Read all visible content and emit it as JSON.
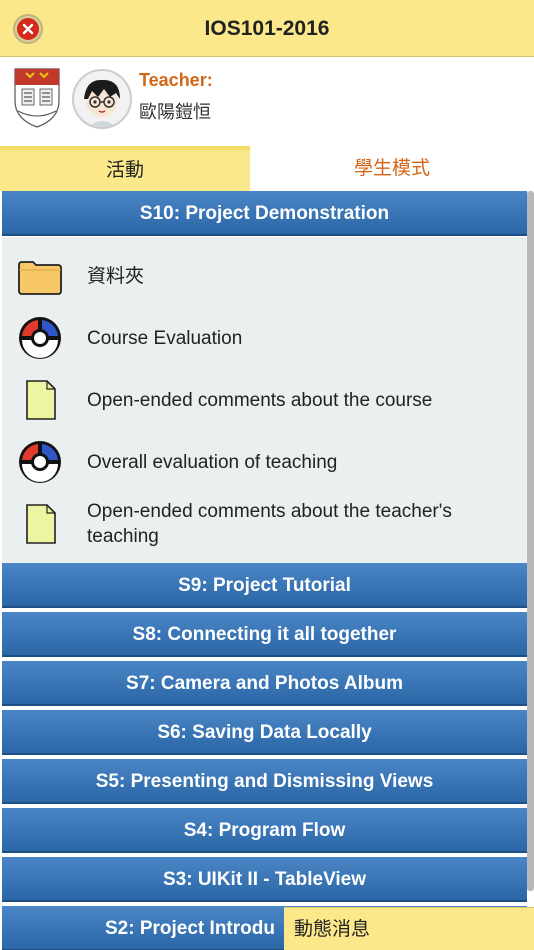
{
  "header": {
    "title": "IOS101-2016"
  },
  "teacher": {
    "label": "Teacher:",
    "name": "歐陽鎧恒"
  },
  "tabs": {
    "activity": "活動",
    "student_mode": "學生模式"
  },
  "sessions": {
    "s10": "S10: Project Demonstration",
    "s9": "S9: Project Tutorial",
    "s8": "S8: Connecting it all together",
    "s7": "S7: Camera and Photos Album",
    "s6": "S6: Saving Data Locally",
    "s5": "S5: Presenting and Dismissing Views",
    "s4": "S4: Program Flow",
    "s3": "S3: UIKit II - TableView",
    "s2": "S2: Project Introdu"
  },
  "items": [
    {
      "label": "資料夾",
      "icon": "folder-icon"
    },
    {
      "label": "Course Evaluation",
      "icon": "evaluation-icon"
    },
    {
      "label": "Open-ended comments about the course",
      "icon": "document-icon"
    },
    {
      "label": "Overall evaluation of teaching",
      "icon": "evaluation-icon"
    },
    {
      "label": "Open-ended comments about the teacher's teaching",
      "icon": "document-icon"
    }
  ],
  "bottom": {
    "news_label": "動態消息"
  },
  "colors": {
    "accent_yellow": "#fbe88a",
    "session_blue": "#3a76b6",
    "teacher_orange": "#d4661a",
    "close_red": "#d42a1e"
  }
}
